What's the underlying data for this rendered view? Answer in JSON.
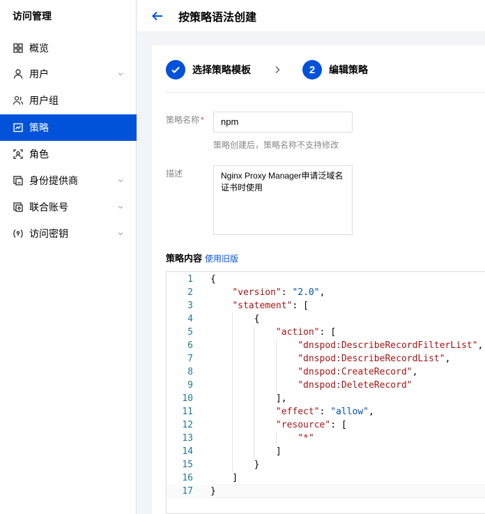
{
  "sidebar": {
    "title": "访问管理",
    "items": [
      {
        "label": "概览",
        "icon": "grid-icon",
        "chevron": false,
        "active": false
      },
      {
        "label": "用户",
        "icon": "user-icon",
        "chevron": true,
        "active": false
      },
      {
        "label": "用户组",
        "icon": "user-group-icon",
        "chevron": false,
        "active": false
      },
      {
        "label": "策略",
        "icon": "policy-icon",
        "chevron": false,
        "active": true
      },
      {
        "label": "角色",
        "icon": "role-icon",
        "chevron": false,
        "active": false
      },
      {
        "label": "身份提供商",
        "icon": "identity-provider-icon",
        "chevron": true,
        "active": false
      },
      {
        "label": "联合账号",
        "icon": "federated-account-icon",
        "chevron": true,
        "active": false
      },
      {
        "label": "访问密钥",
        "icon": "access-key-icon",
        "chevron": true,
        "active": false
      }
    ]
  },
  "header": {
    "title": "按策略语法创建"
  },
  "steps": {
    "step1_label": "选择策略模板",
    "step2_number": "2",
    "step2_label": "编辑策略"
  },
  "form": {
    "name_label": "策略名称",
    "name_required_mark": "*",
    "name_value": "npm",
    "name_hint": "策略创建后，策略名称不支持修改",
    "desc_label": "描述",
    "desc_value": "Nginx Proxy Manager申请泛域名证书时使用"
  },
  "policy_section": {
    "title": "策略内容",
    "legacy_link": "使用旧版"
  },
  "editor": {
    "lines": [
      [
        [
          "p",
          "{"
        ]
      ],
      [
        [
          "p",
          "    "
        ],
        [
          "k",
          "\"version\""
        ],
        [
          "p",
          ": "
        ],
        [
          "s",
          "\"2.0\""
        ],
        [
          "p",
          ","
        ]
      ],
      [
        [
          "p",
          "    "
        ],
        [
          "k",
          "\"statement\""
        ],
        [
          "p",
          ": ["
        ]
      ],
      [
        [
          "p",
          "        {"
        ]
      ],
      [
        [
          "p",
          "            "
        ],
        [
          "k",
          "\"action\""
        ],
        [
          "p",
          ": ["
        ]
      ],
      [
        [
          "p",
          "                "
        ],
        [
          "k",
          "\"dnspod:DescribeRecordFilterList\""
        ],
        [
          "p",
          ","
        ]
      ],
      [
        [
          "p",
          "                "
        ],
        [
          "k",
          "\"dnspod:DescribeRecordList\""
        ],
        [
          "p",
          ","
        ]
      ],
      [
        [
          "p",
          "                "
        ],
        [
          "k",
          "\"dnspod:CreateRecord\""
        ],
        [
          "p",
          ","
        ]
      ],
      [
        [
          "p",
          "                "
        ],
        [
          "k",
          "\"dnspod:DeleteRecord\""
        ]
      ],
      [
        [
          "p",
          "            ],"
        ]
      ],
      [
        [
          "p",
          "            "
        ],
        [
          "k",
          "\"effect\""
        ],
        [
          "p",
          ": "
        ],
        [
          "s",
          "\"allow\""
        ],
        [
          "p",
          ","
        ]
      ],
      [
        [
          "p",
          "            "
        ],
        [
          "k",
          "\"resource\""
        ],
        [
          "p",
          ": ["
        ]
      ],
      [
        [
          "p",
          "                "
        ],
        [
          "k",
          "\"*\""
        ]
      ],
      [
        [
          "p",
          "            ]"
        ]
      ],
      [
        [
          "p",
          "        }"
        ]
      ],
      [
        [
          "p",
          "    ]"
        ]
      ],
      [
        [
          "p",
          "}"
        ]
      ]
    ]
  },
  "colors": {
    "brand": "#0052d9",
    "json_key": "#a31515",
    "json_string": "#0451a5",
    "line_number": "#237893"
  }
}
